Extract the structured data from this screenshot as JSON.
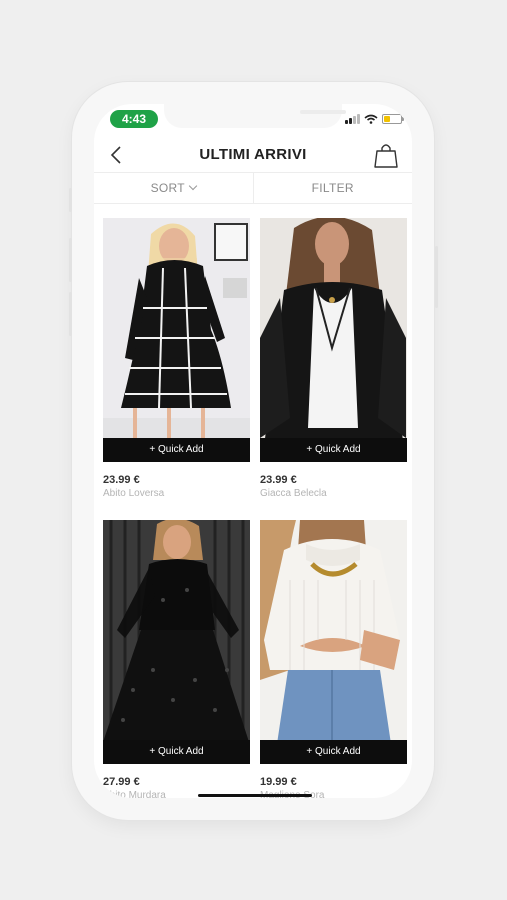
{
  "status_bar": {
    "time": "4:43"
  },
  "nav": {
    "title": "ULTIMI ARRIVI",
    "back_icon": "chevron-left-icon",
    "bag_icon": "shopping-bag-icon"
  },
  "filters": {
    "sort_label": "SORT",
    "filter_label": "FILTER"
  },
  "colors": {
    "time_pill": "#1fa247",
    "quick_add_bg": "#0d0d0d"
  },
  "products": [
    {
      "price": "23.99 €",
      "name": "Abito Loversa",
      "quick_add": "+ Quick Add"
    },
    {
      "price": "23.99 €",
      "name": "Giacca Belecla",
      "quick_add": "+ Quick Add"
    },
    {
      "price": "27.99 €",
      "name": "Abito Murdara",
      "quick_add": "+ Quick Add"
    },
    {
      "price": "19.99 €",
      "name": "Maglione Sora",
      "quick_add": "+ Quick Add"
    }
  ]
}
